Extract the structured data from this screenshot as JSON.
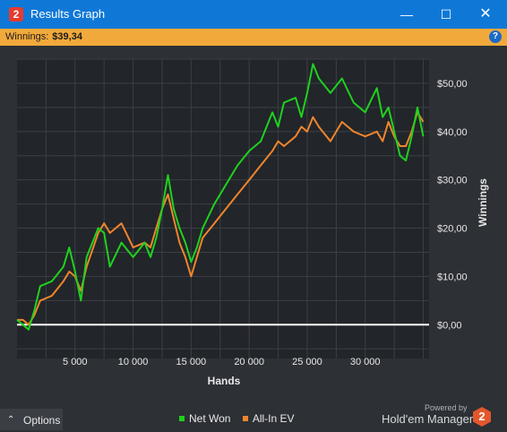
{
  "window": {
    "title": "Results Graph",
    "logo_char": "2",
    "minimize_glyph": "—",
    "maximize_glyph": "☐",
    "close_glyph": "✕"
  },
  "info_bar": {
    "label": "Winnings:",
    "value": "$39,34",
    "help_glyph": "?"
  },
  "chart_data": {
    "type": "line",
    "xlabel": "Hands",
    "ylabel": "Winnings",
    "xlim": [
      0,
      35500
    ],
    "ylim": [
      -7,
      55
    ],
    "x_ticks": [
      5000,
      10000,
      15000,
      20000,
      25000,
      30000
    ],
    "x_tick_labels": [
      "5 000",
      "10 000",
      "15 000",
      "20 000",
      "25 000",
      "30 000"
    ],
    "y_ticks": [
      0,
      10,
      20,
      30,
      40,
      50
    ],
    "y_tick_labels": [
      "$0,00",
      "$10,00",
      "$20,00",
      "$30,00",
      "$40,00",
      "$50,00"
    ],
    "grid": true,
    "legend_position": "bottom-center",
    "series": [
      {
        "name": "Net Won",
        "color": "#1fd11f",
        "x": [
          0,
          500,
          1000,
          1500,
          2000,
          3000,
          4000,
          4500,
          5000,
          5500,
          6000,
          7000,
          7500,
          8000,
          9000,
          10000,
          11000,
          11500,
          12000,
          12500,
          13000,
          13500,
          14000,
          14500,
          15000,
          15500,
          16000,
          17000,
          18000,
          19000,
          20000,
          21000,
          22000,
          22500,
          23000,
          24000,
          24500,
          25000,
          25500,
          26000,
          27000,
          28000,
          29000,
          30000,
          31000,
          31500,
          32000,
          32500,
          33000,
          33500,
          34000,
          34500,
          35000
        ],
        "y": [
          1,
          0,
          -1,
          3,
          8,
          9,
          12,
          16,
          11,
          5,
          14,
          20,
          19,
          12,
          17,
          14,
          17,
          14,
          18,
          24,
          31,
          24,
          20,
          17,
          13,
          16,
          20,
          25,
          29,
          33,
          36,
          38,
          44,
          41,
          46,
          47,
          43,
          48,
          54,
          51,
          48,
          51,
          46,
          44,
          49,
          43,
          45,
          40,
          35,
          34,
          39,
          45,
          39
        ]
      },
      {
        "name": "All-In EV",
        "color": "#f0852d",
        "x": [
          0,
          500,
          1000,
          1500,
          2000,
          3000,
          4000,
          4500,
          5000,
          5500,
          6000,
          7000,
          7500,
          8000,
          9000,
          10000,
          11000,
          11500,
          12000,
          12500,
          13000,
          13500,
          14000,
          14500,
          15000,
          15500,
          16000,
          17000,
          18000,
          19000,
          20000,
          21000,
          22000,
          22500,
          23000,
          24000,
          24500,
          25000,
          25500,
          26000,
          27000,
          28000,
          29000,
          30000,
          31000,
          31500,
          32000,
          32500,
          33000,
          33500,
          34000,
          34500,
          35000
        ],
        "y": [
          1,
          1,
          0,
          2,
          5,
          6,
          9,
          11,
          10,
          7,
          12,
          19,
          21,
          19,
          21,
          16,
          17,
          16,
          20,
          24,
          27,
          22,
          17,
          14,
          10,
          14,
          18,
          21,
          24,
          27,
          30,
          33,
          36,
          38,
          37,
          39,
          41,
          40,
          43,
          41,
          38,
          42,
          40,
          39,
          40,
          38,
          42,
          39,
          37,
          37,
          40,
          44,
          42
        ]
      }
    ],
    "zero_line_color": "#ffffff"
  },
  "bottom": {
    "options_label": "Options",
    "options_chevron": "⌃",
    "powered_by": "Powered by",
    "brand": "Hold'em Manager",
    "brand_logo_char": "2"
  }
}
